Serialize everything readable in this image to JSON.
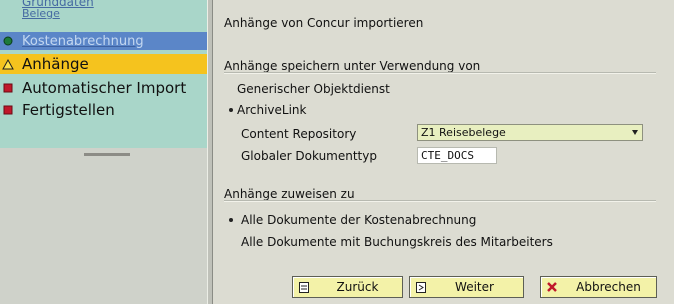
{
  "nav": {
    "items": [
      {
        "label": "Grunddaten",
        "state": "faded"
      },
      {
        "label": "Belege",
        "state": "faded"
      },
      {
        "label": "Kostenabrechnung",
        "state": "selected-faded"
      },
      {
        "label": "Anhänge",
        "state": "active"
      },
      {
        "label": "Automatischer Import",
        "state": "normal"
      },
      {
        "label": "Fertigstellen",
        "state": "normal"
      }
    ]
  },
  "main": {
    "title": "Anhänge von Concur importieren",
    "storage_group": {
      "title": "Anhänge speichern unter Verwendung von",
      "options": [
        {
          "label": "Generischer Objektdienst",
          "selected": false
        },
        {
          "label": "ArchiveLink",
          "selected": true
        }
      ],
      "content_repository_label": "Content Repository",
      "content_repository_value": "Z1 Reisebelege",
      "document_type_label": "Globaler Dokumenttyp",
      "document_type_value": "CTE_DOCS"
    },
    "assign_group": {
      "title": "Anhänge zuweisen zu",
      "options": [
        {
          "label": "Alle Dokumente der Kostenabrechnung",
          "selected": true
        },
        {
          "label": "Alle Dokumente mit Buchungskreis des Mitarbeiters",
          "selected": false
        }
      ]
    }
  },
  "buttons": {
    "back": "Zurück",
    "next": "Weiter",
    "cancel": "Abbrechen"
  },
  "colors": {
    "active": "#f5c31e",
    "nav_bg": "#a9d6c9",
    "button_bg": "#f3f2a8",
    "repo_field_bg": "#e8efc0"
  }
}
